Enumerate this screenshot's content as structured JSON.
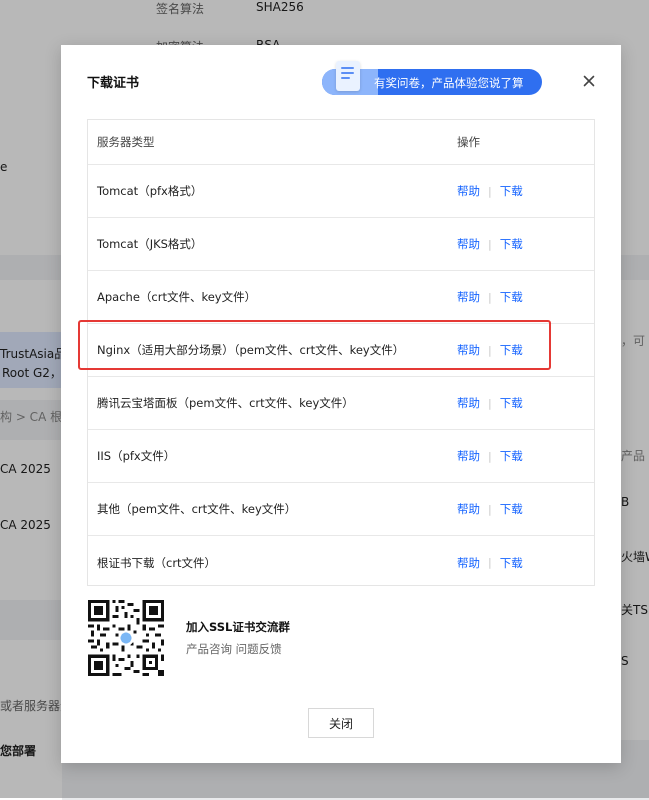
{
  "background": {
    "sign_algo_label": "签名算法",
    "sign_algo_value": "SHA256",
    "key_algo_label": "加密算法",
    "key_algo_value": "RSA",
    "left_texts": [
      "e",
      "TrustAsia品",
      "Root G2，",
      "构 > CA 根",
      "CA 2025",
      "CA 2025",
      "或者服务器资",
      "您部署"
    ],
    "right_texts": [
      "，可",
      "产品",
      "B",
      "火墙W",
      "关TS",
      "S"
    ]
  },
  "modal": {
    "title": "下载证书",
    "promo_text": "有奖问卷，产品体验您说了算",
    "table": {
      "headers": {
        "type": "服务器类型",
        "ops": "操作"
      },
      "help_label": "帮助",
      "download_label": "下载",
      "rows": [
        "Tomcat（pfx格式）",
        "Tomcat（JKS格式）",
        "Apache（crt文件、key文件）",
        "Nginx（适用大部分场景）（pem文件、crt文件、key文件）",
        "腾讯云宝塔面板（pem文件、crt文件、key文件）",
        "IIS（pfx文件）",
        "其他（pem文件、crt文件、key文件）",
        "根证书下载（crt文件）"
      ]
    },
    "group": {
      "title": "加入SSL证书交流群",
      "subtitle": "产品咨询 问题反馈"
    },
    "close_button": "关闭"
  },
  "colors": {
    "link": "#1664ff",
    "promo": "#2f6ff0",
    "highlight": "#e53935"
  }
}
